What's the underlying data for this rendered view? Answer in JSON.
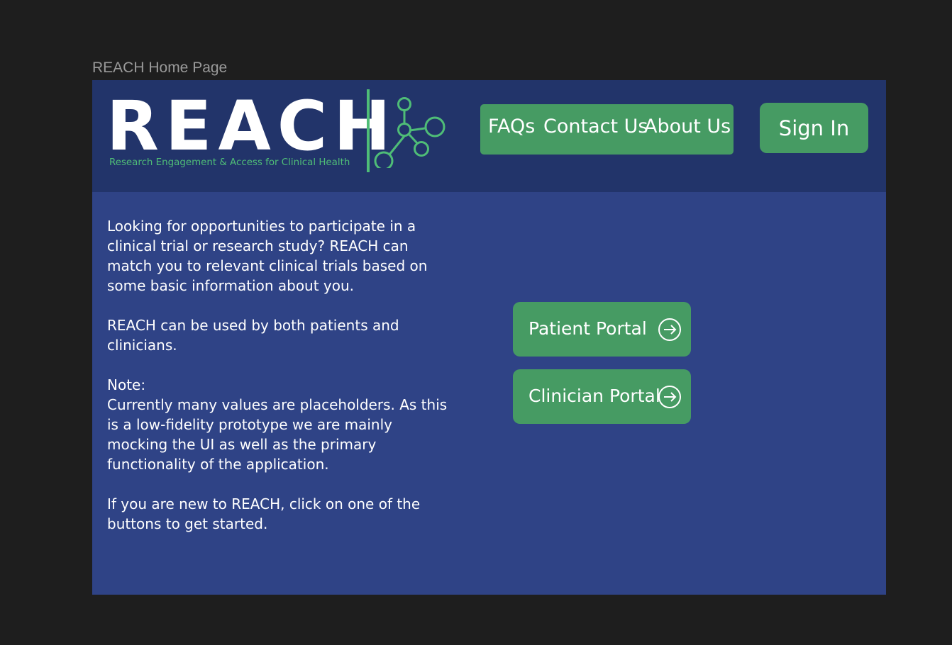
{
  "frame": {
    "label": "REACH Home Page"
  },
  "header": {
    "logo": {
      "wordmark": "REACH",
      "tagline": "Research Engagement & Access for Clinical Health"
    },
    "nav": {
      "faqs": "FAQs",
      "contact": "Contact Us",
      "about": "About Us"
    },
    "sign_in": "Sign In"
  },
  "intro": {
    "p1": "Looking for opportunities to participate in a clinical trial or research study? REACH can match you to relevant clinical trials based on some basic information about you.",
    "p2": "REACH can be used by both patients and clinicians.",
    "note_label": "Note:",
    "note_text": "Currently many values are placeholders. As this is a low-fidelity prototype we are mainly mocking the UI as well as the primary functionality of the application.",
    "p4": "If you are new to REACH, click on one of the buttons to get started."
  },
  "portals": {
    "patient": {
      "label": "Patient Portal",
      "icon": "arrow-right-circle-icon"
    },
    "clinician": {
      "label": "Clinician Portal",
      "icon": "arrow-right-circle-icon"
    }
  },
  "colors": {
    "background": "#1e1e1e",
    "frame": "#2f4386",
    "header": "#22346a",
    "accent_green": "#469b63",
    "logo_green": "#4fbd77",
    "text": "#ffffff"
  }
}
